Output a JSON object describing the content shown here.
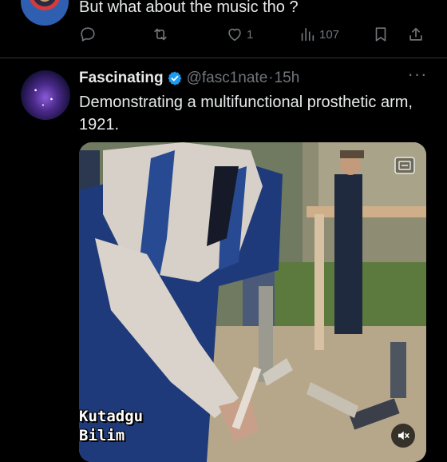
{
  "previous_tweet": {
    "text": "But what about the music tho ?",
    "actions": {
      "reply_count": "",
      "retweet_count": "",
      "like_count": "1",
      "views_count": "107"
    }
  },
  "tweet": {
    "author_name": "Fascinating",
    "handle": "@fasc1nate",
    "separator": "·",
    "time": "15h",
    "more": "···",
    "text": "Demonstrating a multifunctional prosthetic arm, 1921.",
    "media": {
      "watermark_line1": "Kutadgu",
      "watermark_line2": "Bilim",
      "icons": [
        "gif-icon",
        "mute-icon"
      ]
    }
  },
  "colors": {
    "background": "#000000",
    "text": "#e7e9ea",
    "muted": "#71767b",
    "verified": "#1d9bf0",
    "divider": "#2f3336"
  }
}
